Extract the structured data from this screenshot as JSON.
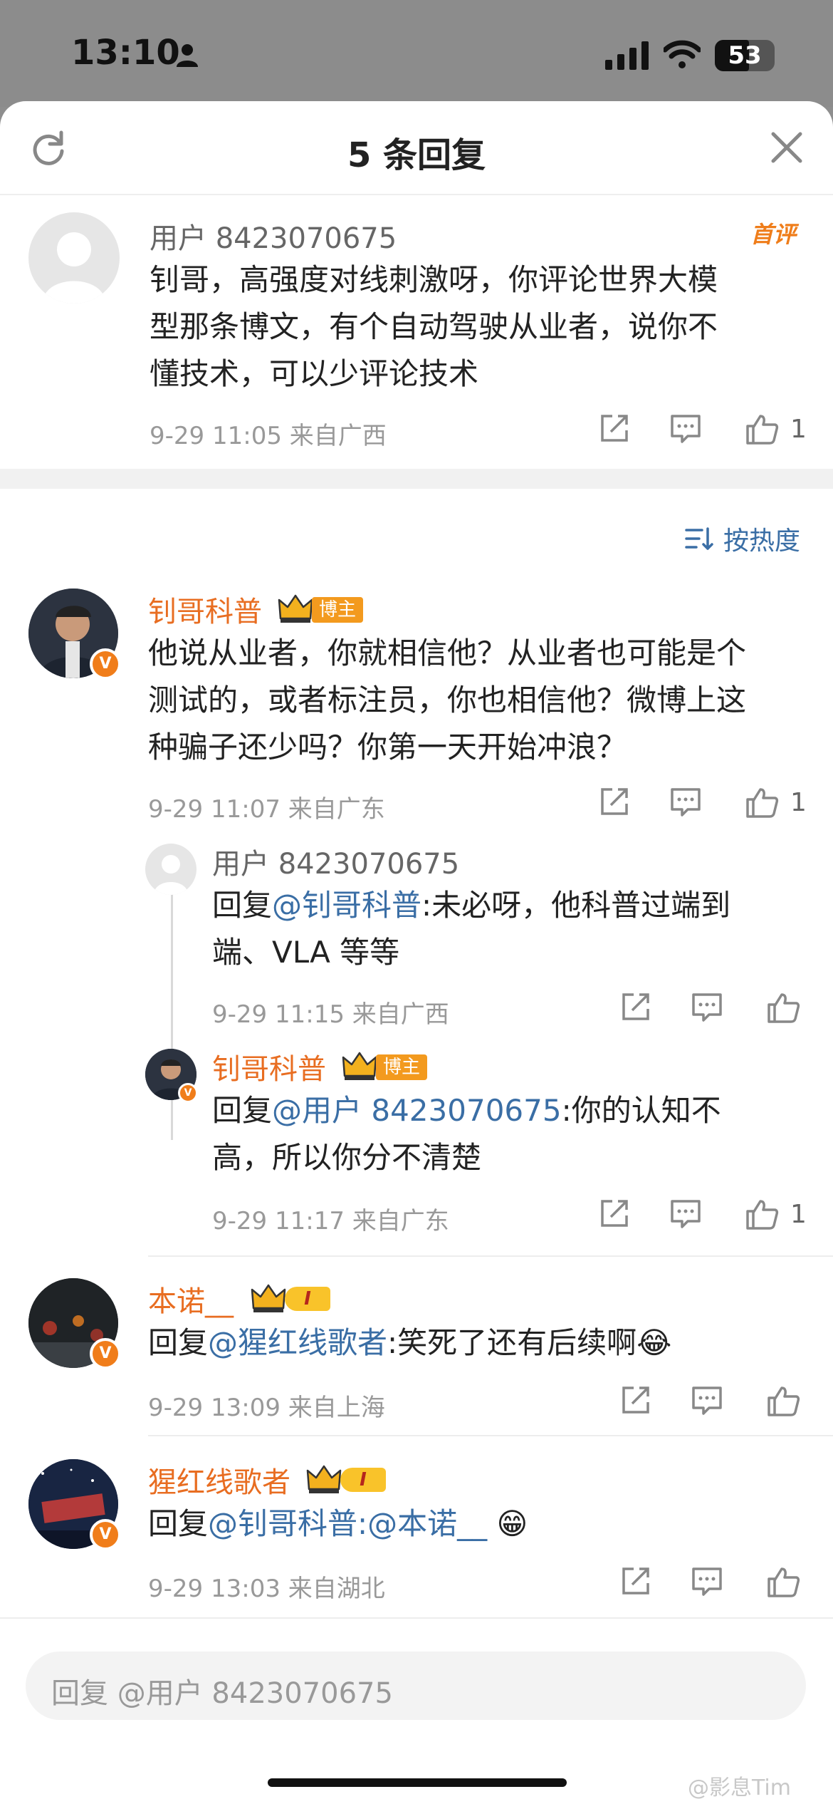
{
  "status_bar": {
    "time": "13:10",
    "battery": "53"
  },
  "header": {
    "title": "5 条回复"
  },
  "main_comment": {
    "user": "用户 8423070675",
    "tag": "首评",
    "text": "钊哥，高强度对线刺激呀，你评论世界大模型那条博文，有个自动驾驶从业者，说你不懂技术，可以少评论技术",
    "line1": "钊哥，高强度对线刺激呀，你评论世界大模",
    "line2": "型那条博文，有个自动驾驶从业者，说你不",
    "line3": "懂技术，可以少评论技术",
    "meta": "9-29 11:05  来自广西",
    "likes": "1"
  },
  "sort_label": "按热度",
  "replies": [
    {
      "user": "钊哥科普",
      "badge": "博主",
      "line1": "他说从业者，你就相信他？从业者也可能是个",
      "line2": "测试的，或者标注员，你也相信他？微博上这",
      "line3": "种骗子还少吗？你第一天开始冲浪？",
      "meta": "9-29 11:07  来自广东",
      "likes": "1"
    },
    {
      "user": "用户 8423070675",
      "prefix": "回复",
      "at": "@钊哥科普",
      "line1": ":未必呀，他科普过端到",
      "line2": "端、VLA 等等",
      "meta": "9-29 11:15  来自广西"
    },
    {
      "user": "钊哥科普",
      "badge": "博主",
      "prefix": "回复",
      "at": "@用户 8423070675",
      "line1": ":你的认知不",
      "line2": "高，所以你分不清楚",
      "meta": "9-29 11:17  来自广东",
      "likes": "1"
    },
    {
      "user": "本诺__",
      "level": "I",
      "prefix": "回复",
      "at": "@猩红线歌者",
      "text": ":笑死了还有后续啊",
      "emoji": "😂",
      "meta": "9-29 13:09  来自上海"
    },
    {
      "user": "猩红线歌者",
      "level": "I",
      "prefix": "回复",
      "at": "@钊哥科普",
      "text": ":@本诺__",
      "emoji": "😁",
      "meta": "9-29 13:03  来自湖北"
    }
  ],
  "reply_input": {
    "placeholder": "回复 @用户 8423070675"
  },
  "watermark": "@影息Tim",
  "colors": {
    "accent_orange": "#e86d21",
    "link_blue": "#3a6ea5",
    "meta_gray": "#999999"
  },
  "icons": [
    "refresh-icon",
    "close-icon",
    "share-icon",
    "comment-icon",
    "like-icon",
    "sort-icon",
    "crown-icon"
  ]
}
